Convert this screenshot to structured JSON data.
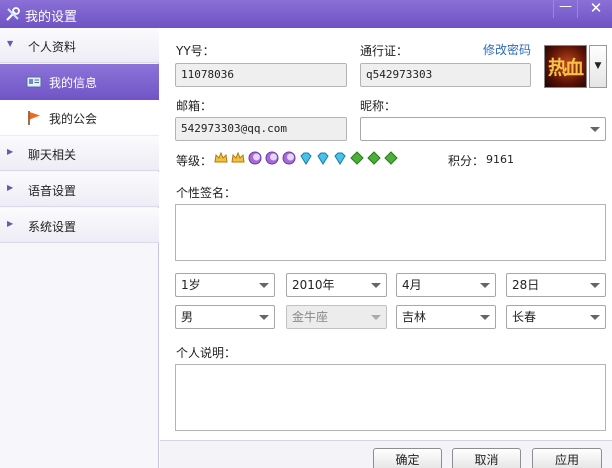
{
  "window": {
    "title": "我的设置",
    "minimize_glyph": "—",
    "close_glyph": "✕"
  },
  "sidebar": {
    "sections": [
      {
        "label": "个人资料",
        "arrow": "▼"
      },
      {
        "label": "聊天相关",
        "arrow": "▶"
      },
      {
        "label": "语音设置",
        "arrow": "▶"
      },
      {
        "label": "系统设置",
        "arrow": "▶"
      }
    ],
    "subitems": [
      {
        "label": "我的信息",
        "icon": "id-card-icon",
        "selected": true
      },
      {
        "label": "我的公会",
        "icon": "flag-icon",
        "selected": false
      }
    ]
  },
  "profile": {
    "yy_label": "YY号：",
    "yy_value": "11078036",
    "passport_label": "通行证：",
    "passport_value": "q542973303",
    "change_password": "修改密码",
    "email_label": "邮箱：",
    "email_value": "542973303@qq.com",
    "nickname_label": "昵称：",
    "nickname_value": "",
    "avatar_text": "热血",
    "avatar_dropdown_glyph": "▼",
    "level_label": "等级：",
    "level_icons": [
      "crown",
      "crown",
      "moon",
      "moon",
      "moon",
      "diamond",
      "diamond",
      "diamond",
      "leaf",
      "leaf",
      "leaf"
    ],
    "points_label": "积分：",
    "points_value": "9161",
    "signature_label": "个性签名：",
    "signature_value": "",
    "age": "1岁",
    "year": "2010年",
    "month": "4月",
    "day": "28日",
    "gender": "男",
    "zodiac": "金牛座",
    "province": "吉林",
    "city": "长春",
    "description_label": "个人说明：",
    "description_value": ""
  },
  "buttons": {
    "ok": "确定",
    "cancel": "取消",
    "apply": "应用"
  },
  "colors": {
    "title_bar": "#7a5ecb",
    "selected_nav": "#7e63cf",
    "link": "#2d6bb8"
  }
}
